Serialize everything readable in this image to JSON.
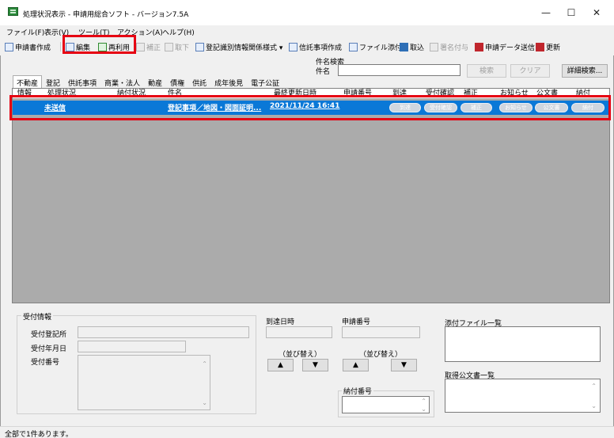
{
  "window": {
    "title": "処理状況表示 - 申請用総合ソフト - バージョン7.5A",
    "minimize": "—",
    "maximize": "☐",
    "close": "✕"
  },
  "menu": [
    "ファイル(F)",
    "表示(V)",
    "ツール(T)",
    "アクション(A)",
    "ヘルプ(H)"
  ],
  "toolbar": {
    "create": "申請書作成",
    "edit": "編集",
    "reuse": "再利用",
    "correct": "補正",
    "withdraw": "取下",
    "registration_info": "登記識別情報関係様式 ▾",
    "trust": "信託事項作成",
    "attach": "ファイル添付",
    "import": "取込",
    "sign": "署名付与",
    "send": "申請データ送信",
    "refresh": "更新"
  },
  "search": {
    "group_label": "件名検索",
    "field_label": "件名",
    "value": "",
    "search_button": "検索",
    "clear_button": "クリア",
    "detail_button": "詳細検索..."
  },
  "tabs": [
    "不動産",
    "登記",
    "供託事項",
    "商業・法人",
    "動産",
    "債権",
    "供託",
    "成年後見",
    "電子公証"
  ],
  "columns": [
    "情報",
    "処理状況",
    "納付状況",
    "件名",
    "最終更新日時",
    "申請番号",
    "到達",
    "受付確認",
    "補正",
    "お知らせ",
    "公文書",
    "納付"
  ],
  "rows": [
    {
      "status": "未送信",
      "payment": "",
      "subject": "登記事項／地図・図面証明...",
      "updated": "2021/11/24 16:41",
      "number": "",
      "buttons": [
        "到達",
        "受付確認",
        "補正",
        "お知らせ",
        "公文書",
        "納付"
      ]
    }
  ],
  "details": {
    "reception_title": "受付情報",
    "reception_office": "受付登記所",
    "reception_date": "受付年月日",
    "reception_number": "受付番号",
    "arrival_title": "到達日時",
    "sort_label": "（並び替え）",
    "up": "▲",
    "down": "▼",
    "app_number_title": "申請番号",
    "sort_label2": "（並び替え）",
    "payment_number_title": "納付番号",
    "attachments_title": "添付ファイル一覧",
    "documents_title": "取得公文書一覧"
  },
  "status": "全部で1件あります。"
}
